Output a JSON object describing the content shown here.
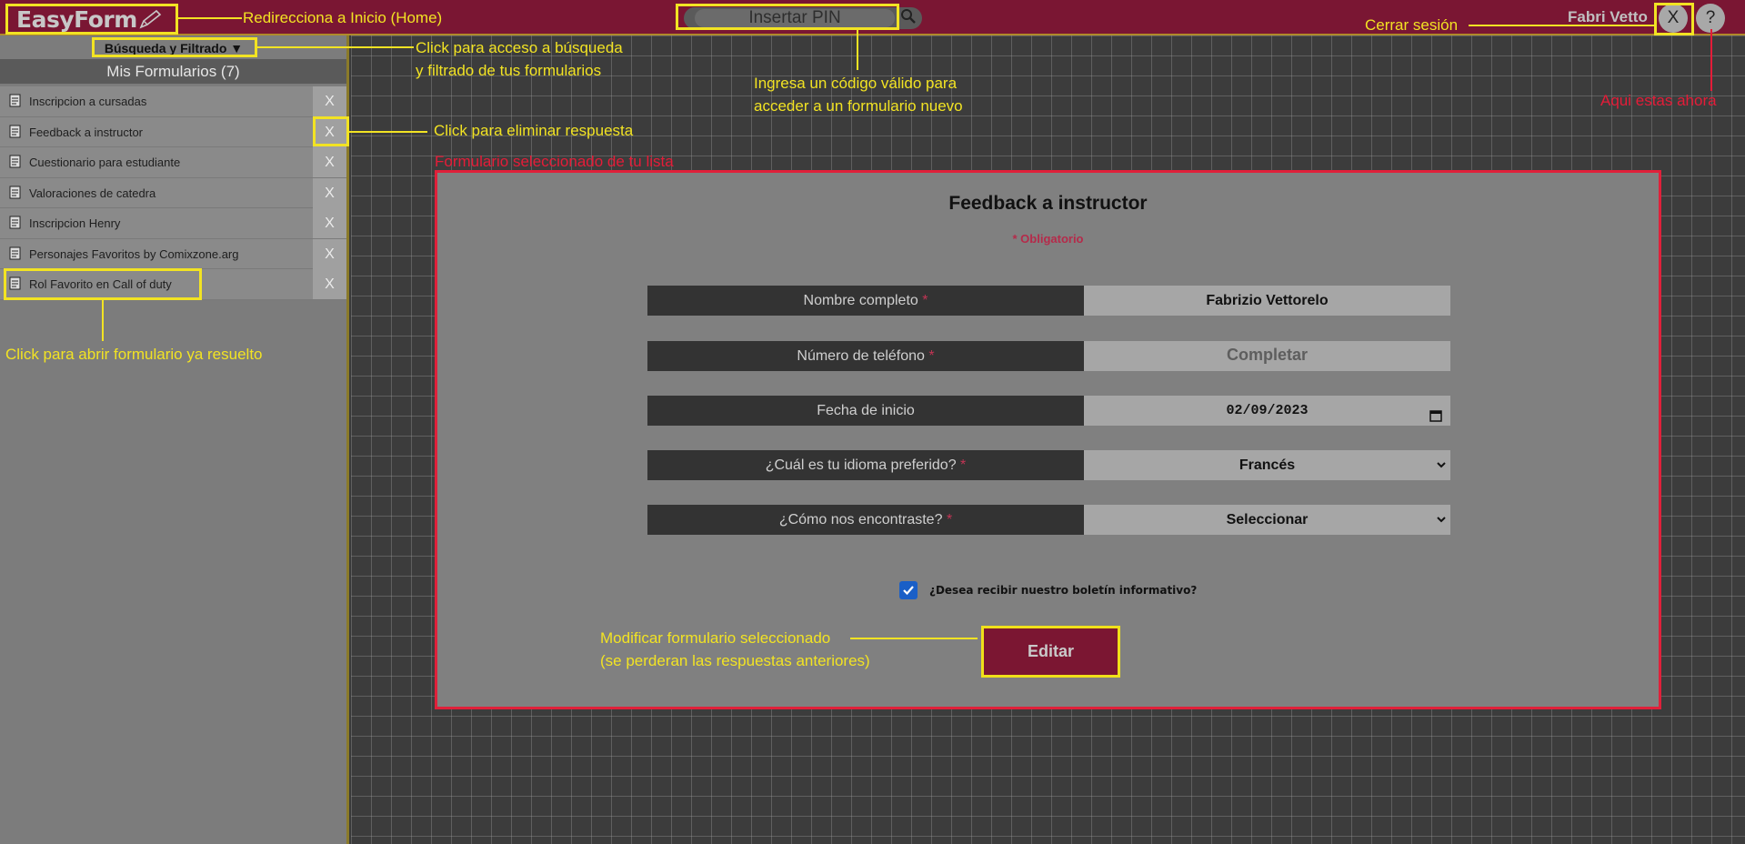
{
  "header": {
    "logo": "EasyForm",
    "pin_placeholder": "Insertar PIN",
    "user_name": "Fabri Vetto",
    "logout_label": "X",
    "help_label": "?"
  },
  "sidebar": {
    "filter_label": "Búsqueda y Filtrado ▼",
    "list_title": "Mis Formularios (7)",
    "items": [
      {
        "label": "Inscripcion a cursadas",
        "delete": "X"
      },
      {
        "label": "Feedback a instructor",
        "delete": "X"
      },
      {
        "label": "Cuestionario para estudiante",
        "delete": "X"
      },
      {
        "label": "Valoraciones de catedra",
        "delete": "X"
      },
      {
        "label": "Inscripcion Henry",
        "delete": "X"
      },
      {
        "label": "Personajes Favoritos by Comixzone.arg",
        "delete": "X"
      },
      {
        "label": "Rol Favorito en Call of duty",
        "delete": "X"
      }
    ]
  },
  "form": {
    "title": "Feedback a instructor",
    "required_note": "* Obligatorio",
    "fields": [
      {
        "label": "Nombre completo",
        "required": "*",
        "value": "Fabrizio Vettorelo"
      },
      {
        "label": "Número de teléfono",
        "required": "*",
        "value": "Completar"
      },
      {
        "label": "Fecha de inicio",
        "required": "",
        "value": "02/09/2023"
      },
      {
        "label": "¿Cuál es tu idioma preferido?",
        "required": "*",
        "value": "Francés"
      },
      {
        "label": "¿Cómo nos encontraste?",
        "required": "*",
        "value": "Seleccionar"
      }
    ],
    "newsletter_label": "¿Desea recibir nuestro boletín informativo?",
    "newsletter_checked": true,
    "edit_button": "Editar"
  },
  "annotations": {
    "home": "Redirecciona a Inicio (Home)",
    "filter_line1": "Click para acceso a búsqueda",
    "filter_line2": "y filtrado de tus formularios",
    "pin_line1": "Ingresa un código válido para",
    "pin_line2": "acceder a un formulario nuevo",
    "logout": "Cerrar sesión",
    "help": "Aqui estas ahora",
    "delete": "Click para eliminar respuesta",
    "selected": "Formulario seleccionado de tu lista",
    "open": "Click para abrir formulario ya resuelto",
    "edit_line1": "Modificar formulario seleccionado",
    "edit_line2": "(se perderan las respuestas anteriores)"
  },
  "colors": {
    "brand": "#7a1633",
    "annotation": "#f2e323",
    "annotation_red": "#e51c38",
    "required": "#c23454",
    "checkbox": "#1a5fc7"
  }
}
